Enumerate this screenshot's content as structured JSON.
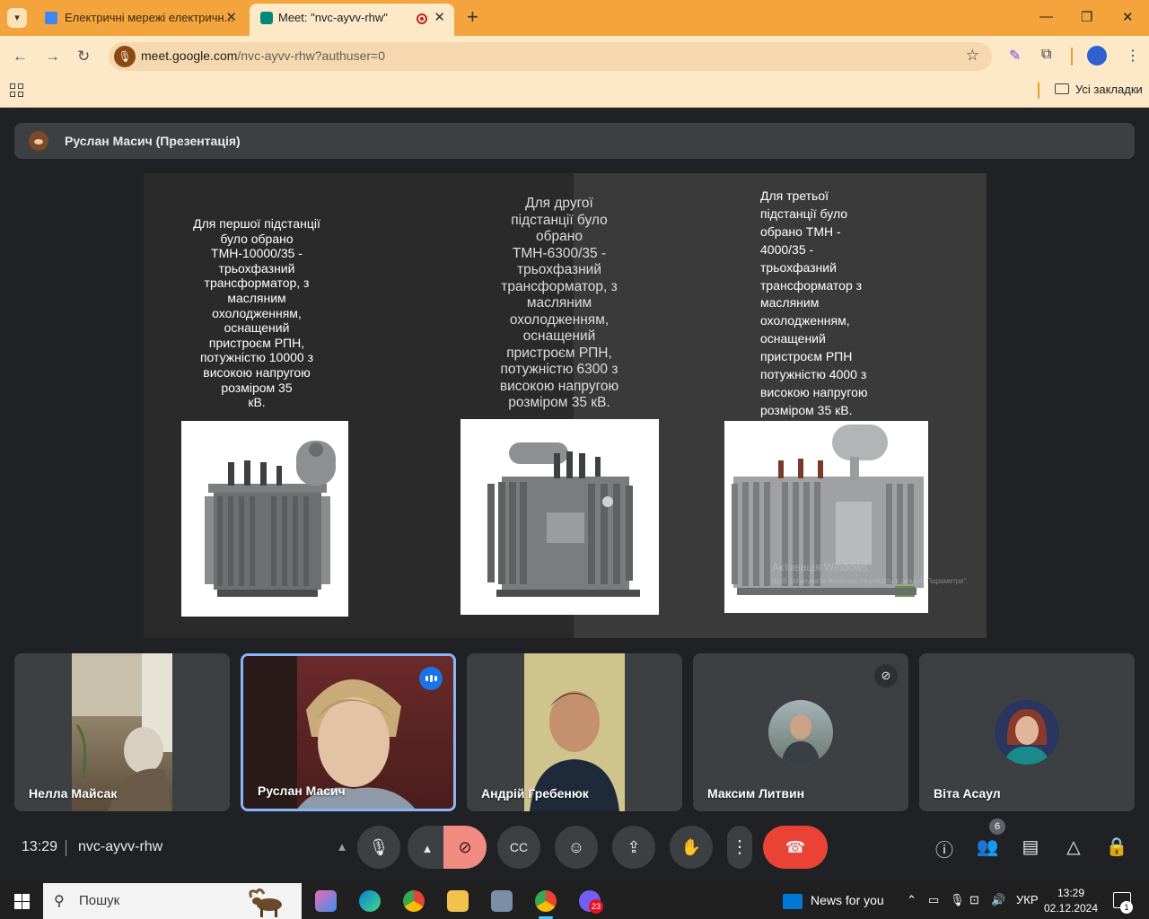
{
  "browser": {
    "tabs": [
      {
        "title": "Електричні мережі електричн..."
      },
      {
        "title": "Meet: \"nvc-ayvv-rhw\""
      }
    ],
    "url_host": "meet.google.com",
    "url_path": "/nvc-ayvv-rhw?authuser=0",
    "bookmarks_folder": "Усі закладки"
  },
  "meet": {
    "presenter_label": "Руслан Масич (Презентація)",
    "clock": "13:29",
    "meeting_code": "nvc-ayvv-rhw",
    "participants_count": "6"
  },
  "slide": {
    "column_1_text": "Для першої підстанції\nбуло обрано\nТМН-10000/35 -\nтрьохфазний\nтрансформатор, з\nмасляним\nохолодженням,\nоснащений\nпристроєм РПН,\nпотужністю 10000 з\nвисокою напругою\nрозміром 35\nкВ.",
    "column_2_text": "Для другої\nпідстанції було\nобрано\nТМН-6300/35 -\nтрьохфазний\nтрансформатор, з\nмасляним\nохолодженням,\nоснащений\nпристроєм РПН,\nпотужністю 6300 з\nвисокою напругою\nрозміром 35 кВ.",
    "column_3_text": "Для третьої\nпідстанції було\nобрано ТМН -\n4000/35 -\nтрьохфазний\nтрансформатор з\nмасляним\nохолодженням,\nоснащений\nпристроєм РПН\nпотужністю 4000 з\nвисокою напругою\nрозміром 35 кВ.",
    "watermark_line1": "Активація Windows",
    "watermark_line2": "Щоб активувати Windows, перейдіть в розділ \"Параметри\"."
  },
  "participants": [
    {
      "name": "Нелла Майсак"
    },
    {
      "name": "Руслан Масич"
    },
    {
      "name": "Андрій Гребенюк"
    },
    {
      "name": "Максим Литвин"
    },
    {
      "name": "Віта Асаул"
    }
  ],
  "taskbar": {
    "search_placeholder": "Пошук",
    "news_label": "News for you",
    "language": "УКР",
    "time": "13:29",
    "date": "02.12.2024",
    "app_badge": "23",
    "notification_count": "1"
  },
  "colors": {
    "tabstrip": "#f4a43c",
    "toolbar": "#fde8c8",
    "meet_background": "#202124",
    "end_call": "#ea4335",
    "active_speaker": "#8ab4f8"
  }
}
